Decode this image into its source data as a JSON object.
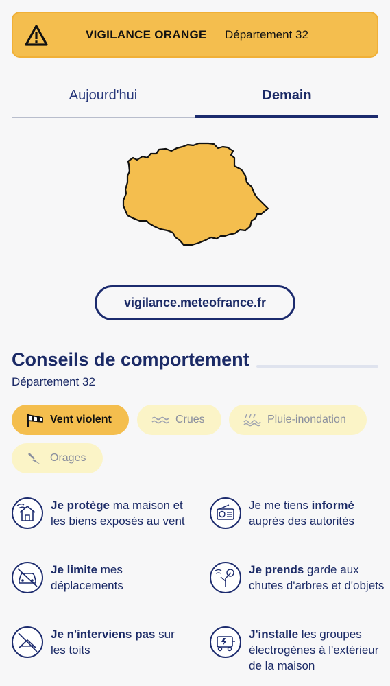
{
  "alert": {
    "level": "VIGILANCE ORANGE",
    "department": "Département 32",
    "color": "#f4be4e",
    "icon": "warning-triangle-icon"
  },
  "tabs": [
    {
      "label": "Aujourd'hui",
      "active": false
    },
    {
      "label": "Demain",
      "active": true
    }
  ],
  "map": {
    "region_color": "#f4be4e",
    "outline_color": "#111111"
  },
  "link": {
    "label": "vigilance.meteofrance.fr"
  },
  "section": {
    "title": "Conseils de comportement",
    "subtitle": "Département 32"
  },
  "chips": [
    {
      "label": "Vent violent",
      "icon": "wind-sock-icon",
      "active": true
    },
    {
      "label": "Crues",
      "icon": "waves-icon",
      "active": false
    },
    {
      "label": "Pluie-inondation",
      "icon": "rain-flood-icon",
      "active": false
    },
    {
      "label": "Orages",
      "icon": "lightning-icon",
      "active": false
    }
  ],
  "advice": [
    {
      "bold": "Je protège",
      "rest": " ma maison et les biens exposés au vent",
      "icon": "house-wind-icon"
    },
    {
      "bold_pre": "Je me tiens ",
      "bold": "informé",
      "rest": " auprès des autorités",
      "icon": "radio-icon"
    },
    {
      "bold": "Je limite",
      "rest": " mes déplacements",
      "icon": "no-car-icon"
    },
    {
      "bold": "Je prends",
      "rest": " garde aux chutes d'arbres et d'objets",
      "icon": "falling-tree-icon"
    },
    {
      "bold": "Je n'interviens pas",
      "rest": " sur les toits",
      "icon": "no-roof-icon"
    },
    {
      "bold": "J'installe",
      "rest": " les groupes électrogènes à l'extérieur de la maison",
      "icon": "generator-icon"
    }
  ],
  "colors": {
    "navy": "#1c2b6e",
    "orange": "#f4be4e",
    "chip_inactive": "#fbf4c7",
    "background": "#f7f7f8"
  }
}
